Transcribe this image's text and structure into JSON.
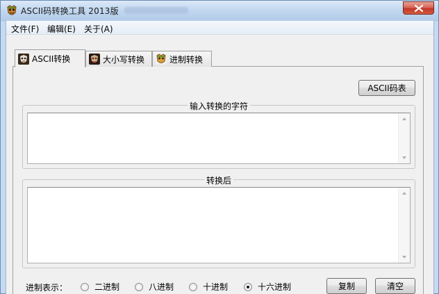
{
  "window": {
    "title": "ASCII码转换工具 2013版",
    "close_icon": "close-x-icon",
    "app_icon": "app-mask-icon"
  },
  "menu": [
    {
      "label": "文件(F)"
    },
    {
      "label": "编辑(E)"
    },
    {
      "label": "关于(A)"
    }
  ],
  "tabs": [
    {
      "label": "ASCII转换",
      "icon": "mask-icon-dark",
      "active": true
    },
    {
      "label": "大小写转换",
      "icon": "mask-icon-red",
      "active": false
    },
    {
      "label": "进制转换",
      "icon": "mask-icon-gold",
      "active": false
    }
  ],
  "ascii_table_button": "ASCII码表",
  "input_group": {
    "label": "输入转换的字符",
    "value": ""
  },
  "output_group": {
    "label": "转换后",
    "value": ""
  },
  "base": {
    "label": "进制表示：",
    "options": [
      {
        "label": "二进制",
        "checked": false
      },
      {
        "label": "八进制",
        "checked": false
      },
      {
        "label": "十进制",
        "checked": false
      },
      {
        "label": "十六进制",
        "checked": true
      }
    ]
  },
  "copy_button": "复制",
  "clear_button": "清空",
  "colors": {
    "title_bar": "#c3d8f0",
    "close_button": "#c94a3a",
    "client_bg": "#f0f0f0"
  }
}
